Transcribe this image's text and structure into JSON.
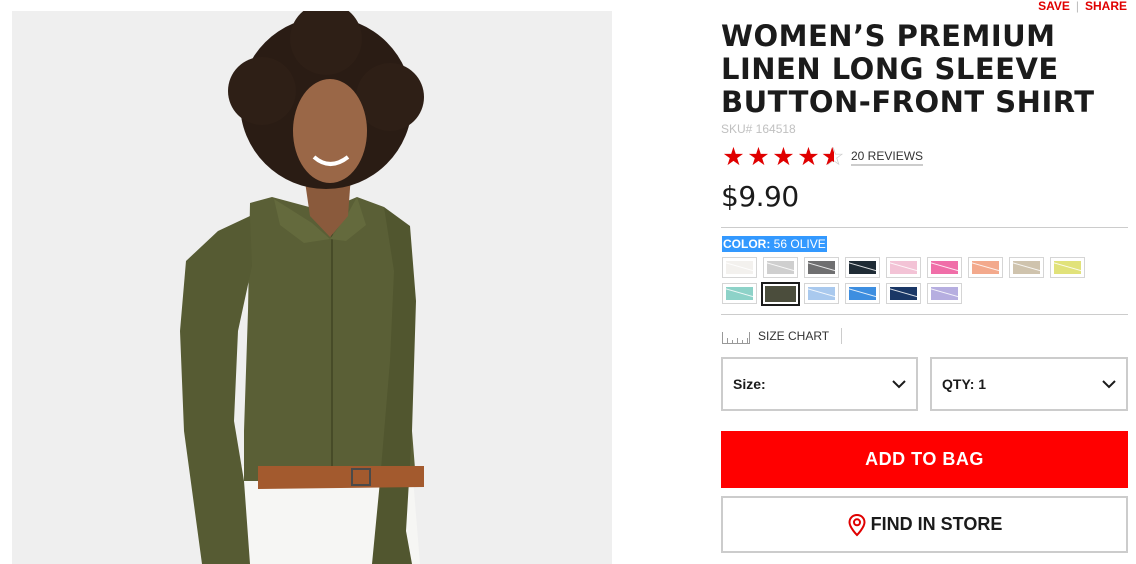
{
  "header_links": {
    "save": "SAVE",
    "separator": "|",
    "share": "SHARE"
  },
  "product": {
    "title": "WOMEN’S PREMIUM LINEN LONG SLEEVE BUTTON-FRONT SHIRT",
    "sku": "SKU# 164518",
    "rating": 4.5,
    "rating_max": 5,
    "reviews": "20 REVIEWS",
    "price": "$9.90"
  },
  "color": {
    "label": "COLOR:",
    "selected": "56 OLIVE",
    "swatches": [
      {
        "hex": "#f3f1ee",
        "selected": false
      },
      {
        "hex": "#cfcfcf",
        "selected": false
      },
      {
        "hex": "#6f6f70",
        "selected": false
      },
      {
        "hex": "#1f2b35",
        "selected": false
      },
      {
        "hex": "#f3c3d6",
        "selected": false
      },
      {
        "hex": "#f06ea8",
        "selected": false
      },
      {
        "hex": "#f3a98c",
        "selected": false
      },
      {
        "hex": "#cfc3ad",
        "selected": false
      },
      {
        "hex": "#e1e27a",
        "selected": false
      },
      {
        "hex": "#8dd2c8",
        "selected": false
      },
      {
        "hex": "#4b4d3c",
        "selected": true
      },
      {
        "hex": "#a9c9ee",
        "selected": false
      },
      {
        "hex": "#3d8ee0",
        "selected": false
      },
      {
        "hex": "#1a3766",
        "selected": false
      },
      {
        "hex": "#b6aee0",
        "selected": false
      }
    ]
  },
  "size_chart": "SIZE CHART",
  "size_select": {
    "label": "Size:"
  },
  "qty_select": {
    "label": "QTY: 1"
  },
  "add_to_bag": "ADD TO BAG",
  "find_in_store": "FIND IN STORE",
  "colors": {
    "accent": "#ff0000",
    "text": "#1b1b1b",
    "border": "#cccccc",
    "highlight": "#3399ff"
  }
}
